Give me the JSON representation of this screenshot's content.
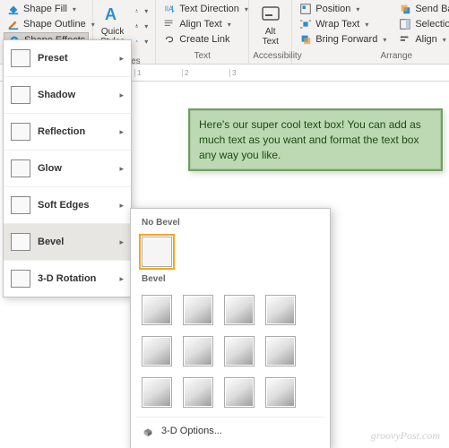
{
  "ribbon": {
    "shapeStyles": {
      "fill": "Shape Fill",
      "outline": "Shape Outline",
      "effects": "Shape Effects"
    },
    "wordart": {
      "group": "rt Styles",
      "quick": "Quick\nStyles"
    },
    "text": {
      "group": "Text",
      "direction": "Text Direction",
      "align": "Align Text",
      "link": "Create Link"
    },
    "accessibility": {
      "group": "Accessibility",
      "alt": "Alt\nText"
    },
    "arrange": {
      "group": "Arrange",
      "position": "Position",
      "wrap": "Wrap Text",
      "forward": "Bring Forward",
      "backward": "Send Backward",
      "selection": "Selection Pane",
      "align": "Align"
    }
  },
  "effectsMenu": {
    "items": [
      {
        "label": "Preset"
      },
      {
        "label": "Shadow"
      },
      {
        "label": "Reflection"
      },
      {
        "label": "Glow"
      },
      {
        "label": "Soft Edges"
      },
      {
        "label": "Bevel"
      },
      {
        "label": "3-D Rotation"
      }
    ]
  },
  "bevelMenu": {
    "noBevel": "No Bevel",
    "bevel": "Bevel",
    "options": "3-D Options..."
  },
  "textbox": "Here's our super cool text box! You can add as much text as you want and format the text box any way you like.",
  "ruler": [
    "1",
    "2",
    "3"
  ],
  "watermark": "groovyPost.com"
}
